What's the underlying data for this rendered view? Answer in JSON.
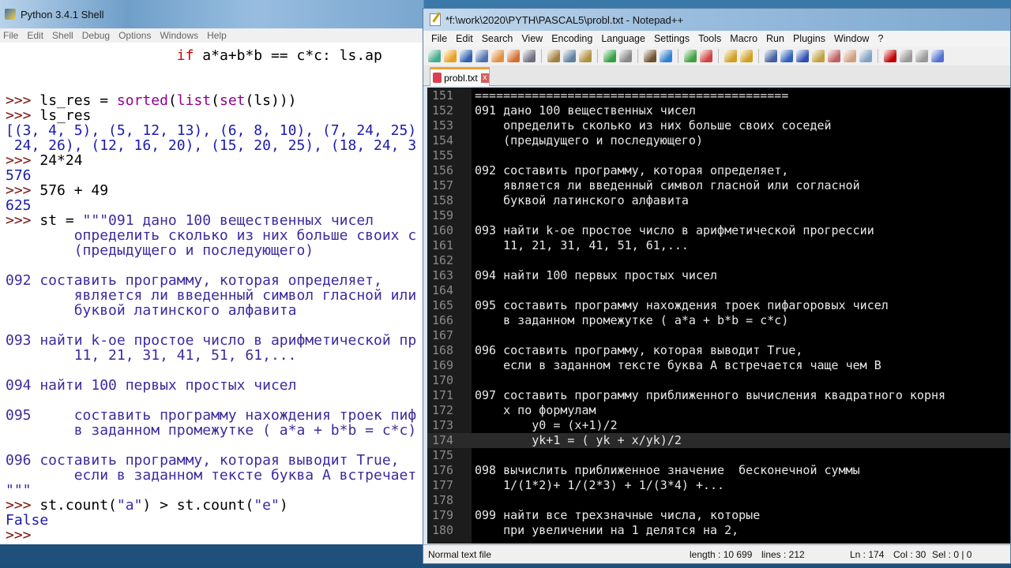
{
  "python_shell": {
    "title": "Python 3.4.1 Shell",
    "menu": [
      "File",
      "Edit",
      "Shell",
      "Debug",
      "Options",
      "Windows",
      "Help"
    ],
    "lines": [
      [
        {
          "k": "code",
          "t": "                    "
        },
        {
          "k": "kw",
          "t": "if"
        },
        {
          "k": "code",
          "t": " a*a+b*b == c*c: ls.ap"
        }
      ],
      [],
      [],
      [
        {
          "k": "prompt",
          "t": ">>> "
        },
        {
          "k": "code",
          "t": "ls_res = "
        },
        {
          "k": "builtin",
          "t": "sorted"
        },
        {
          "k": "code",
          "t": "("
        },
        {
          "k": "builtin",
          "t": "list"
        },
        {
          "k": "code",
          "t": "("
        },
        {
          "k": "builtin",
          "t": "set"
        },
        {
          "k": "code",
          "t": "(ls)))"
        }
      ],
      [
        {
          "k": "prompt",
          "t": ">>> "
        },
        {
          "k": "code",
          "t": "ls_res"
        }
      ],
      [
        {
          "k": "out",
          "t": "[(3, 4, 5), (5, 12, 13), (6, 8, 10), (7, 24, 25)"
        }
      ],
      [
        {
          "k": "out",
          "t": " 24, 26), (12, 16, 20), (15, 20, 25), (18, 24, 3"
        }
      ],
      [
        {
          "k": "prompt",
          "t": ">>> "
        },
        {
          "k": "code",
          "t": "24*24"
        }
      ],
      [
        {
          "k": "out",
          "t": "576"
        }
      ],
      [
        {
          "k": "prompt",
          "t": ">>> "
        },
        {
          "k": "code",
          "t": "576 + 49"
        }
      ],
      [
        {
          "k": "out",
          "t": "625"
        }
      ],
      [
        {
          "k": "prompt",
          "t": ">>> "
        },
        {
          "k": "code",
          "t": "st = "
        },
        {
          "k": "str",
          "t": "\"\"\"091 дано 100 вещественных чисел"
        }
      ],
      [
        {
          "k": "str",
          "t": "        определить сколько из них больше своих с"
        }
      ],
      [
        {
          "k": "str",
          "t": "        (предыдущего и последующего)"
        }
      ],
      [],
      [
        {
          "k": "str",
          "t": "092 составить программу, которая определяет,"
        }
      ],
      [
        {
          "k": "str",
          "t": "        является ли введенный символ гласной или"
        }
      ],
      [
        {
          "k": "str",
          "t": "        буквой латинского алфавита"
        }
      ],
      [],
      [
        {
          "k": "str",
          "t": "093 найти k-ое простое число в арифметической пр"
        }
      ],
      [
        {
          "k": "str",
          "t": "        11, 21, 31, 41, 51, 61,..."
        }
      ],
      [],
      [
        {
          "k": "str",
          "t": "094 найти 100 первых простых чисел"
        }
      ],
      [],
      [
        {
          "k": "str",
          "t": "095     составить программу нахождения троек пиф"
        }
      ],
      [
        {
          "k": "str",
          "t": "        в заданном промежутке ( a*a + b*b = c*c)"
        }
      ],
      [],
      [
        {
          "k": "str",
          "t": "096 составить программу, которая выводит True,"
        }
      ],
      [
        {
          "k": "str",
          "t": "        если в заданном тексте буква А встречает"
        }
      ],
      [
        {
          "k": "str",
          "t": "\"\"\""
        }
      ],
      [
        {
          "k": "prompt",
          "t": ">>> "
        },
        {
          "k": "code",
          "t": "st.count("
        },
        {
          "k": "str",
          "t": "\"a\""
        },
        {
          "k": "code",
          "t": ") > st.count("
        },
        {
          "k": "str",
          "t": "\"e\""
        },
        {
          "k": "code",
          "t": ")"
        }
      ],
      [
        {
          "k": "out",
          "t": "False"
        }
      ],
      [
        {
          "k": "prompt",
          "t": ">>> "
        }
      ]
    ]
  },
  "notepad": {
    "title": "*f:\\work\\2020\\PYTH\\PASCAL5\\probl.txt - Notepad++",
    "menu": [
      "File",
      "Edit",
      "Search",
      "View",
      "Encoding",
      "Language",
      "Settings",
      "Tools",
      "Macro",
      "Run",
      "Plugins",
      "Window",
      "?"
    ],
    "tab": {
      "label": "probl.txt",
      "close": "x"
    },
    "current_line": 174,
    "lines": [
      {
        "n": "151",
        "t": "============================================"
      },
      {
        "n": "152",
        "t": "091 дано 100 вещественных чисел"
      },
      {
        "n": "153",
        "t": "    определить сколько из них больше своих соседей"
      },
      {
        "n": "154",
        "t": "    (предыдущего и последующего)"
      },
      {
        "n": "155",
        "t": ""
      },
      {
        "n": "156",
        "t": "092 составить программу, которая определяет,"
      },
      {
        "n": "157",
        "t": "    является ли введенный символ гласной или согласной"
      },
      {
        "n": "158",
        "t": "    буквой латинского алфавита"
      },
      {
        "n": "159",
        "t": ""
      },
      {
        "n": "160",
        "t": "093 найти k-ое простое число в арифметической прогрессии"
      },
      {
        "n": "161",
        "t": "    11, 21, 31, 41, 51, 61,..."
      },
      {
        "n": "162",
        "t": ""
      },
      {
        "n": "163",
        "t": "094 найти 100 первых простых чисел"
      },
      {
        "n": "164",
        "t": ""
      },
      {
        "n": "165",
        "t": "095 составить программу нахождения троек пифагоровых чисел"
      },
      {
        "n": "166",
        "t": "    в заданном промежутке ( a*a + b*b = c*c)"
      },
      {
        "n": "167",
        "t": ""
      },
      {
        "n": "168",
        "t": "096 составить программу, которая выводит True,"
      },
      {
        "n": "169",
        "t": "    если в заданном тексте буква А встречается чаще чем В"
      },
      {
        "n": "170",
        "t": ""
      },
      {
        "n": "171",
        "t": "097 составить программу приближенного вычисления квадратного корня"
      },
      {
        "n": "172",
        "t": "    x по формулам"
      },
      {
        "n": "173",
        "t": "        y0 = (x+1)/2"
      },
      {
        "n": "174",
        "t": "        yk+1 = ( yk + x/yk)/2"
      },
      {
        "n": "175",
        "t": ""
      },
      {
        "n": "176",
        "t": "098 вычислить приближенное значение  бесконечной суммы"
      },
      {
        "n": "177",
        "t": "    1/(1*2)+ 1/(2*3) + 1/(3*4) +..."
      },
      {
        "n": "178",
        "t": ""
      },
      {
        "n": "179",
        "t": "099 найти все трехзначные числа, которые"
      },
      {
        "n": "180",
        "t": "    при увеличении на 1 делятся на 2,"
      }
    ],
    "status": {
      "type": "Normal text file",
      "length": "length : 10 699",
      "lines": "lines : 212",
      "ln": "Ln : 174",
      "col": "Col : 30",
      "sel": "Sel : 0 | 0"
    }
  }
}
